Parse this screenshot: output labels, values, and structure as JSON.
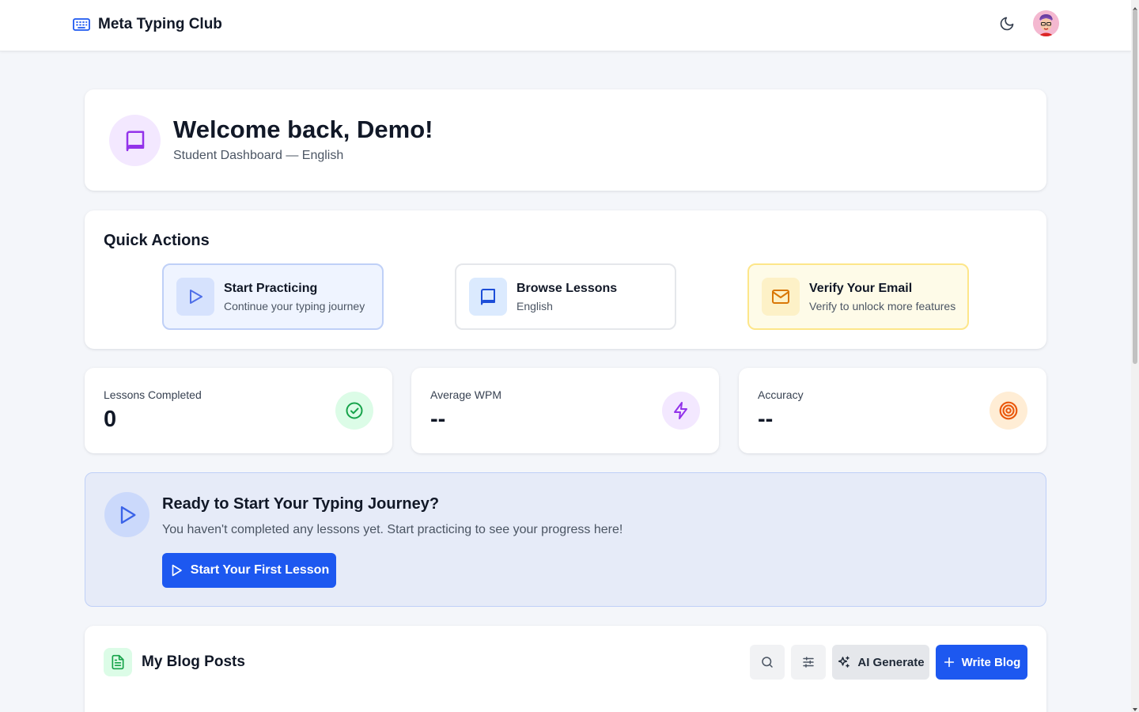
{
  "header": {
    "brand_name": "Meta Typing Club",
    "brand_icon": "keyboard-icon",
    "theme_toggle_icon": "moon-icon",
    "avatar_icon": "user-avatar"
  },
  "welcome": {
    "title": "Welcome back, Demo!",
    "subtitle": "Student Dashboard — English",
    "icon": "book-icon"
  },
  "quick_actions": {
    "title": "Quick Actions",
    "items": [
      {
        "title": "Start Practicing",
        "subtitle": "Continue your typing journey",
        "icon": "play-icon"
      },
      {
        "title": "Browse Lessons",
        "subtitle": "English",
        "icon": "book-icon"
      },
      {
        "title": "Verify Your Email",
        "subtitle": "Verify to unlock more features",
        "icon": "mail-icon"
      }
    ]
  },
  "stats": [
    {
      "label": "Lessons Completed",
      "value": "0",
      "icon": "check-circle-icon",
      "color": "#16a34a"
    },
    {
      "label": "Average WPM",
      "value": "--",
      "icon": "lightning-icon",
      "color": "#9333ea"
    },
    {
      "label": "Accuracy",
      "value": "--",
      "icon": "target-icon",
      "color": "#ea580c"
    }
  ],
  "journey": {
    "title": "Ready to Start Your Typing Journey?",
    "description": "You haven't completed any lessons yet. Start practicing to see your progress here!",
    "button_label": "Start Your First Lesson"
  },
  "blog": {
    "title": "My Blog Posts",
    "ai_button_label": "AI Generate",
    "write_button_label": "Write Blog"
  },
  "colors": {
    "primary": "#1d58f0",
    "background": "#f4f6fa"
  }
}
